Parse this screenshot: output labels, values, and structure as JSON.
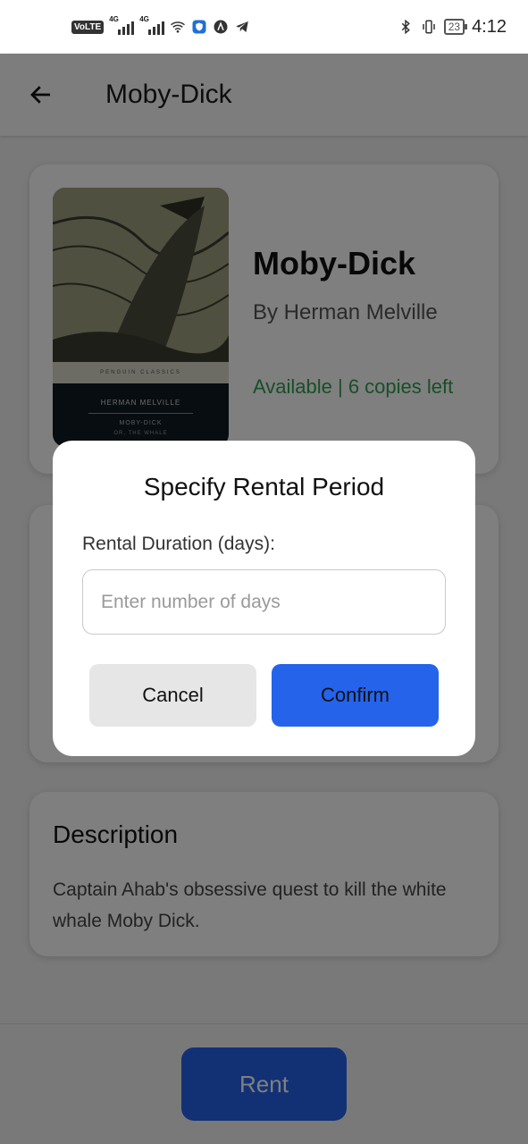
{
  "status_bar": {
    "volte": "VoLTE",
    "net1": "4G",
    "net2": "4G",
    "battery": "23",
    "time": "4:12"
  },
  "app_bar": {
    "title": "Moby-Dick",
    "back_icon": "arrow-left-icon"
  },
  "book": {
    "title": "Moby-Dick",
    "author": "By Herman Melville",
    "availability": "Available | 6 copies left",
    "availability_color": "#2e9e4f",
    "cover": {
      "publisher": "PENGUIN CLASSICS",
      "author": "HERMAN MELVILLE",
      "title": "MOBY-DICK",
      "subtitle": "OR, THE WHALE"
    }
  },
  "description": {
    "heading": "Description",
    "text": "Captain Ahab's obsessive quest to kill the white whale Moby Dick."
  },
  "footer": {
    "rent_label": "Rent"
  },
  "dialog": {
    "title": "Specify Rental Period",
    "label": "Rental Duration (days):",
    "input_placeholder": "Enter number of days",
    "input_value": "",
    "cancel_label": "Cancel",
    "confirm_label": "Confirm"
  },
  "colors": {
    "accent": "#2563eb",
    "scrim": "rgba(0,0,0,0.5)"
  }
}
